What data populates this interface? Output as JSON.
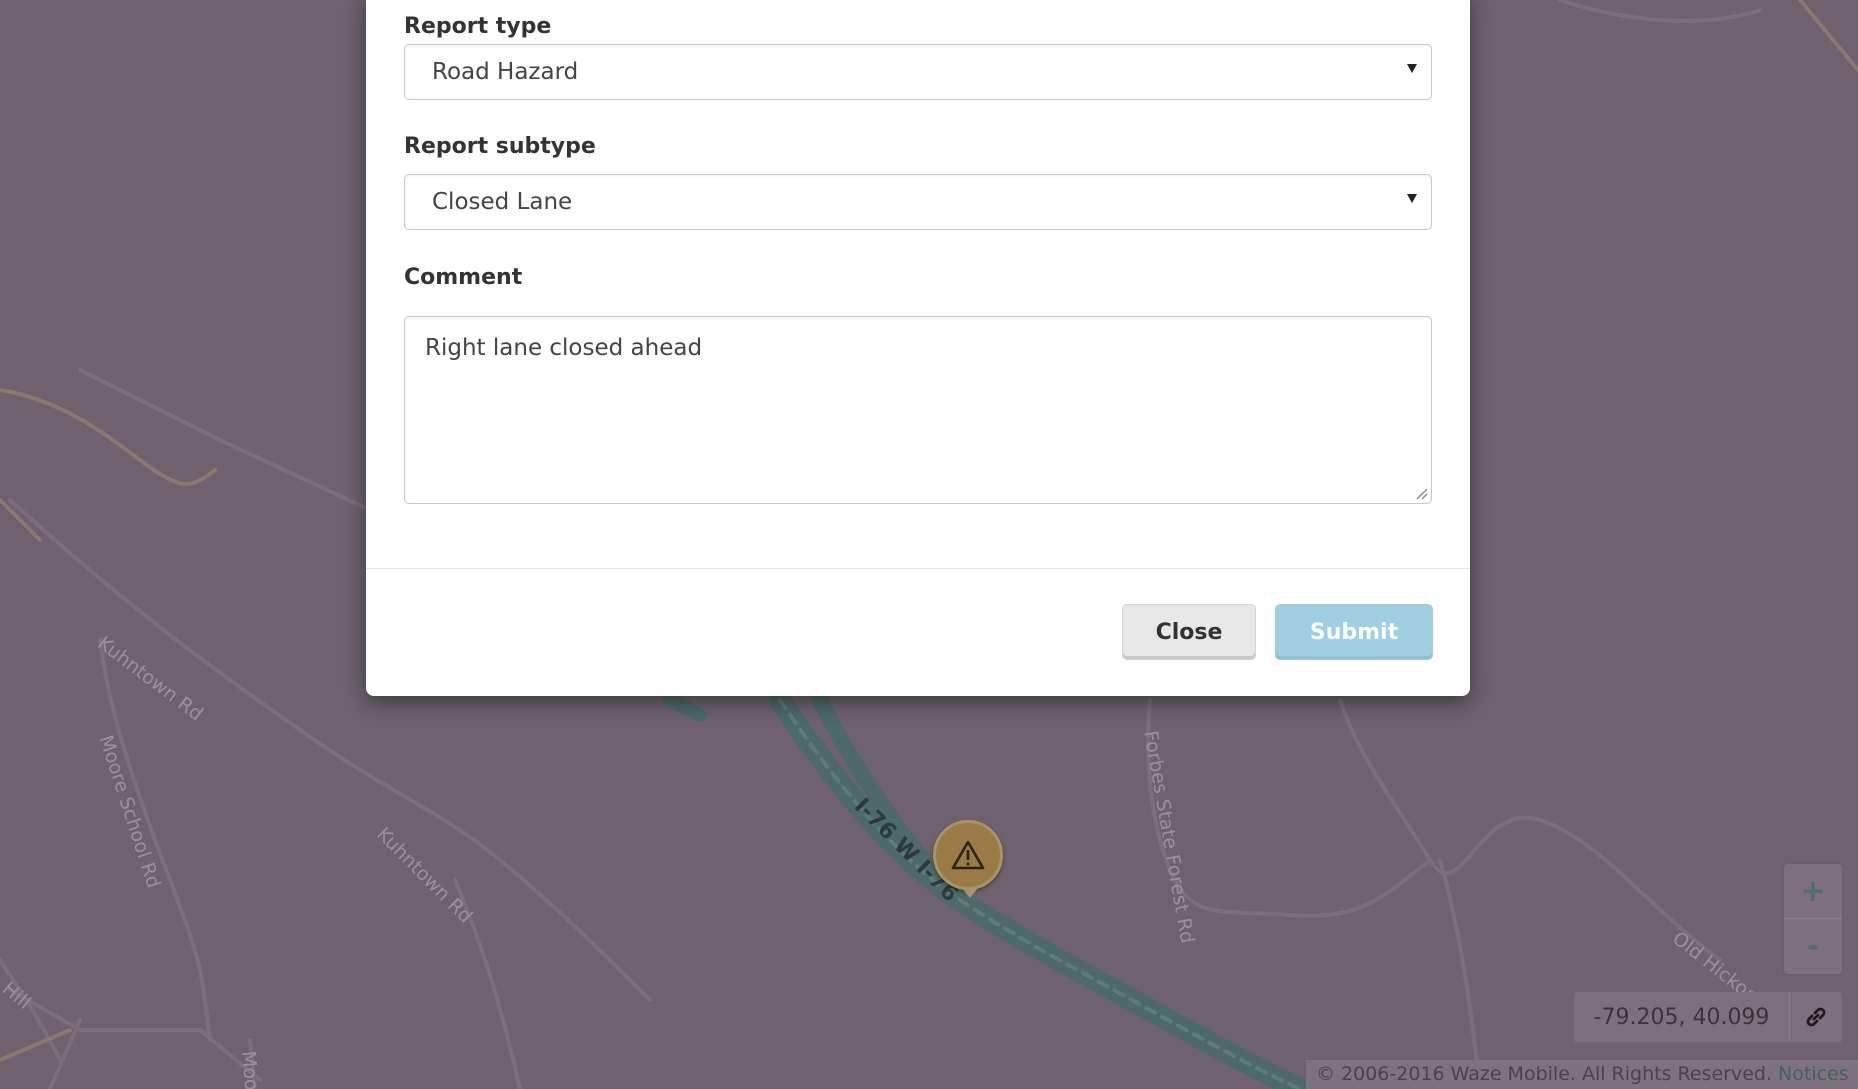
{
  "modal": {
    "report_type_label": "Report type",
    "report_type_value": "Road Hazard",
    "report_subtype_label": "Report subtype",
    "report_subtype_value": "Closed Lane",
    "comment_label": "Comment",
    "comment_value": "Right lane closed ahead",
    "close_label": "Close",
    "submit_label": "Submit"
  },
  "map": {
    "road_labels": {
      "kuhntown_rd_1": "Kuhntown Rd",
      "kuhntown_rd_2": "Kuhntown Rd",
      "moore_school_rd": "Moore School Rd",
      "forbes_state_forest_rd": "Forbes State Forest Rd",
      "old_hickory": "Old Hickor",
      "hill": "Hill",
      "moo": "Moo",
      "i76": "I-76 W  I-76"
    },
    "hazard_icon": "warning-icon",
    "zoom_in_label": "+",
    "zoom_out_label": "-",
    "coordinates": "-79.205, 40.099",
    "link_icon": "link-icon",
    "copyright_text": "© 2006-2016 Waze Mobile. All Rights Reserved.",
    "notices_label": "Notices"
  },
  "colors": {
    "map_background": "#6f626e",
    "highway": "#4b6a68",
    "submit_button": "#9fcfe0",
    "hazard_marker": "#9a7b45"
  }
}
